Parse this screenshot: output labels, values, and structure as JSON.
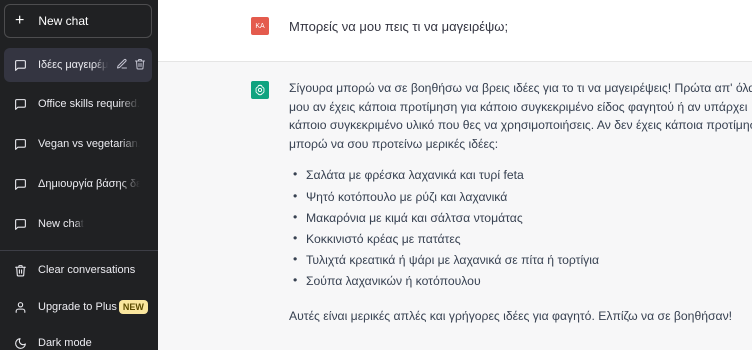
{
  "sidebar": {
    "new_chat_top": "New chat",
    "conversations": [
      {
        "label": "Ιδέες μαγειρέμ",
        "active": true
      },
      {
        "label": "Office skills required.",
        "active": false
      },
      {
        "label": "Vegan vs vegetarian.",
        "active": false
      },
      {
        "label": "Δημιουργία βάσης δε",
        "active": false
      },
      {
        "label": "New chat",
        "active": false
      }
    ],
    "bottom": {
      "clear": "Clear conversations",
      "upgrade": "Upgrade to Plus",
      "upgrade_badge": "NEW",
      "dark_mode": "Dark mode"
    }
  },
  "chat": {
    "user": {
      "initials": "KA",
      "message": "Μπορείς να μου πεις τι να μαγειρέψω;"
    },
    "assistant": {
      "lines": [
        "Σίγουρα μπορώ να σε βοηθήσω να βρεις ιδέες για το τι να μαγειρέψεις! Πρώτα απ' όλα",
        "μου αν έχεις κάποια προτίμηση για κάποιο συγκεκριμένο είδος φαγητού ή αν υπάρχει",
        "κάποιο συγκεκριμένο υλικό που θες να χρησιμοποιήσεις. Αν δεν έχεις κάποια προτίμηση",
        "μπορώ να σου προτείνω μερικές ιδέες:"
      ],
      "bullets": [
        "Σαλάτα με φρέσκα λαχανικά και τυρί feta",
        "Ψητό κοτόπουλο με ρύζι και λαχανικά",
        "Μακαρόνια με κιμά και σάλτσα ντομάτας",
        "Κοκκινιστό κρέας με πατάτες",
        "Τυλιχτά κρεατικά ή ψάρι με λαχανικά σε πίτα ή τορτίγια",
        "Σούπα λαχανικών ή κοτόπουλου"
      ],
      "closing": "Αυτές είναι μερικές απλές και γρήγορες ιδέες για φαγητό. Ελπίζω να σε βοηθήσαν!"
    }
  },
  "colors": {
    "sidebar_bg": "#202123",
    "active_conv_bg": "#343541",
    "user_avatar": "#e45b4d",
    "assistant_avatar": "#10a37f",
    "assistant_row_bg": "#f7f7f8",
    "badge_bg": "#fae69e"
  },
  "icons": {
    "new_chat": "plus-icon",
    "conversation": "chat-bubble-icon",
    "edit": "pencil-icon",
    "delete": "trash-icon",
    "clear": "trash-icon",
    "upgrade": "user-icon",
    "dark_mode": "moon-icon",
    "assistant": "openai-logo-icon"
  }
}
